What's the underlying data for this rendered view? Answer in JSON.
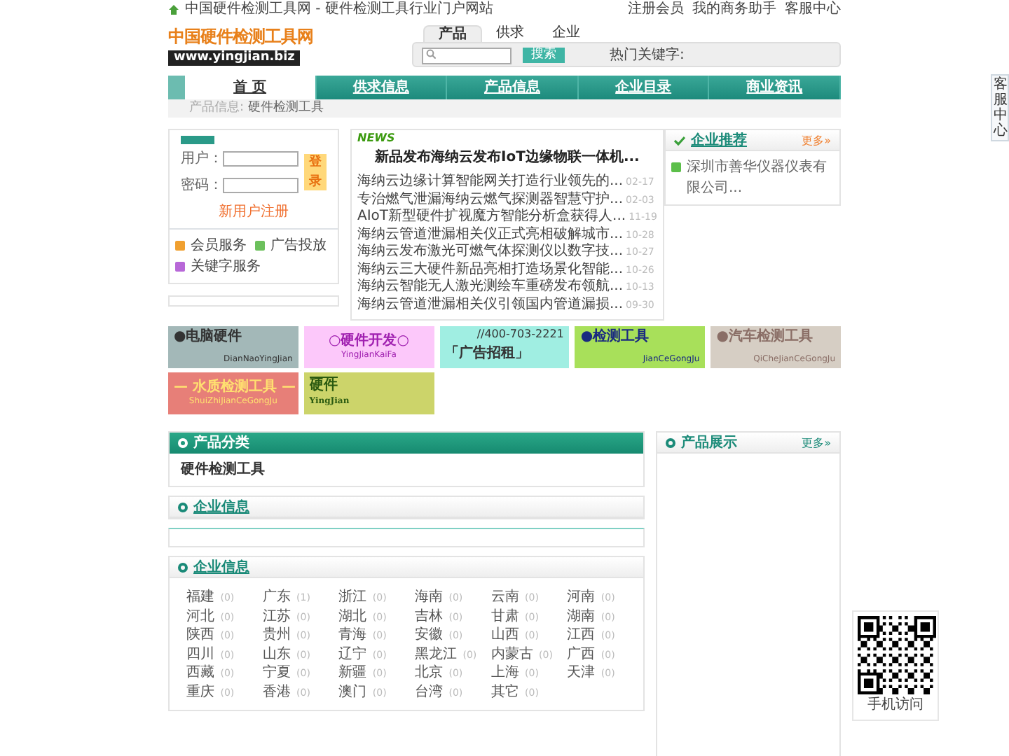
{
  "top_bar": {
    "site_title": "中国硬件检测工具网 - 硬件检测工具行业门户网站",
    "links": [
      "注册会员",
      "我的商务助手",
      "客服中心"
    ]
  },
  "header": {
    "logo_text": "中国硬件检测工具网",
    "logo_url": "www.yingjian.biz",
    "search_tabs": [
      {
        "label": "产品",
        "selected": true
      },
      {
        "label": "供求",
        "selected": false
      },
      {
        "label": "企业",
        "selected": false
      }
    ],
    "search_button": "搜索",
    "hot_keywords_label": "热门关键字:"
  },
  "nav": [
    {
      "label": "首 页",
      "selected": true
    },
    {
      "label": "供求信息",
      "selected": false
    },
    {
      "label": "产品信息",
      "selected": false
    },
    {
      "label": "企业目录",
      "selected": false
    },
    {
      "label": "商业资讯",
      "selected": false
    }
  ],
  "breadcrumb": {
    "label": "产品信息:",
    "current": "硬件检测工具"
  },
  "login": {
    "user_label": "用户：",
    "password_label": "密码：",
    "login_button": "登录",
    "register_link": "新用户注册",
    "services": [
      {
        "label": "会员服务",
        "color": "#f0a030"
      },
      {
        "label": "广告投放",
        "color": "#6cc05c"
      },
      {
        "label": "关键字服务",
        "color": "#b868d8"
      }
    ]
  },
  "news": {
    "tag": "NEWS",
    "headline": "新品发布海纳云发布IoT边缘物联一体机...",
    "items": [
      {
        "title": "海纳云边缘计算智能网关打造行业领先的...",
        "date": "02-17"
      },
      {
        "title": "专治燃气泄漏海纳云燃气探测器智慧守护...",
        "date": "02-03"
      },
      {
        "title": "AIoT新型硬件扩视魔方智能分析盒获得人...",
        "date": "11-19"
      },
      {
        "title": "海纳云管道泄漏相关仪正式亮相破解城市...",
        "date": "10-28"
      },
      {
        "title": "海纳云发布激光可燃气体探测仪以数字技...",
        "date": "10-27"
      },
      {
        "title": "海纳云三大硬件新品亮相打造场景化智能...",
        "date": "10-26"
      },
      {
        "title": "海纳云智能无人激光测绘车重磅发布领航...",
        "date": "10-13"
      },
      {
        "title": "海纳云管道泄漏相关仪引领国内管道漏损...",
        "date": "09-30"
      }
    ]
  },
  "recommend": {
    "title": "企业推荐",
    "more": "更多»",
    "items": [
      "深圳市善华仪器仪表有限公司..."
    ]
  },
  "ads": [
    {
      "kind": "corner",
      "title": {
        "text": "●电脑硬件",
        "color": "#333333"
      },
      "subtitle": "DianNaoYingJian",
      "color": "#a3b8b8"
    },
    {
      "kind": "center",
      "title": {
        "text": "○硬件开发○",
        "color": "#a020b0"
      },
      "subtitle": "YingJianKaiFa",
      "color": "#fcc8fa"
    },
    {
      "kind": "phone",
      "title": {
        "text": "「广告招租」",
        "color": "#333333"
      },
      "subtitle": "//400-703-2221",
      "color": "#a0eee2"
    },
    {
      "kind": "corner",
      "title": {
        "text": "●检测工具",
        "color": "#1a2a80"
      },
      "subtitle": "JianCeGongJu",
      "color": "#a8e05a"
    },
    {
      "kind": "corner",
      "title": {
        "text": "●汽车检测工具",
        "color": "#8a6e66"
      },
      "subtitle": "QiCheJianCeGongJu",
      "color": "#d6cec4"
    },
    {
      "kind": "center",
      "title": {
        "text": "— 水质检测工具 —",
        "color": "#ffe070"
      },
      "subtitle": "ShuiZhiJianCeGongJu",
      "color": "#e77f78"
    },
    {
      "kind": "stacked",
      "title": {
        "text": "硬件",
        "color": "#2a5a10"
      },
      "subtitle": "YingJian",
      "color": "#ccd46a"
    }
  ],
  "product_category": {
    "title": "产品分类",
    "items": [
      "硬件检测工具"
    ]
  },
  "company_info": {
    "title": "企业信息"
  },
  "company_regions": {
    "title": "企业信息",
    "regions": [
      {
        "name": "福建",
        "count": "(0)"
      },
      {
        "name": "广东",
        "count": "(1)"
      },
      {
        "name": "浙江",
        "count": "(0)"
      },
      {
        "name": "海南",
        "count": "(0)"
      },
      {
        "name": "云南",
        "count": "(0)"
      },
      {
        "name": "河南",
        "count": "(0)"
      },
      {
        "name": "河北",
        "count": "(0)"
      },
      {
        "name": "江苏",
        "count": "(0)"
      },
      {
        "name": "湖北",
        "count": "(0)"
      },
      {
        "name": "吉林",
        "count": "(0)"
      },
      {
        "name": "甘肃",
        "count": "(0)"
      },
      {
        "name": "湖南",
        "count": "(0)"
      },
      {
        "name": "陕西",
        "count": "(0)"
      },
      {
        "name": "贵州",
        "count": "(0)"
      },
      {
        "name": "青海",
        "count": "(0)"
      },
      {
        "name": "安徽",
        "count": "(0)"
      },
      {
        "name": "山西",
        "count": "(0)"
      },
      {
        "name": "江西",
        "count": "(0)"
      },
      {
        "name": "四川",
        "count": "(0)"
      },
      {
        "name": "山东",
        "count": "(0)"
      },
      {
        "name": "辽宁",
        "count": "(0)"
      },
      {
        "name": "黑龙江",
        "count": "(0)"
      },
      {
        "name": "内蒙古",
        "count": "(0)"
      },
      {
        "name": "广西",
        "count": "(0)"
      },
      {
        "name": "西藏",
        "count": "(0)"
      },
      {
        "name": "宁夏",
        "count": "(0)"
      },
      {
        "name": "新疆",
        "count": "(0)"
      },
      {
        "name": "北京",
        "count": "(0)"
      },
      {
        "name": "上海",
        "count": "(0)"
      },
      {
        "name": "天津",
        "count": "(0)"
      },
      {
        "name": "重庆",
        "count": "(0)"
      },
      {
        "name": "香港",
        "count": "(0)"
      },
      {
        "name": "澳门",
        "count": "(0)"
      },
      {
        "name": "台湾",
        "count": "(0)"
      },
      {
        "name": "其它",
        "count": "(0)"
      }
    ]
  },
  "product_show": {
    "title": "产品展示",
    "more": "更多»"
  },
  "side_tab": {
    "label": "客服中心"
  },
  "qr": {
    "caption": "手机访问"
  }
}
